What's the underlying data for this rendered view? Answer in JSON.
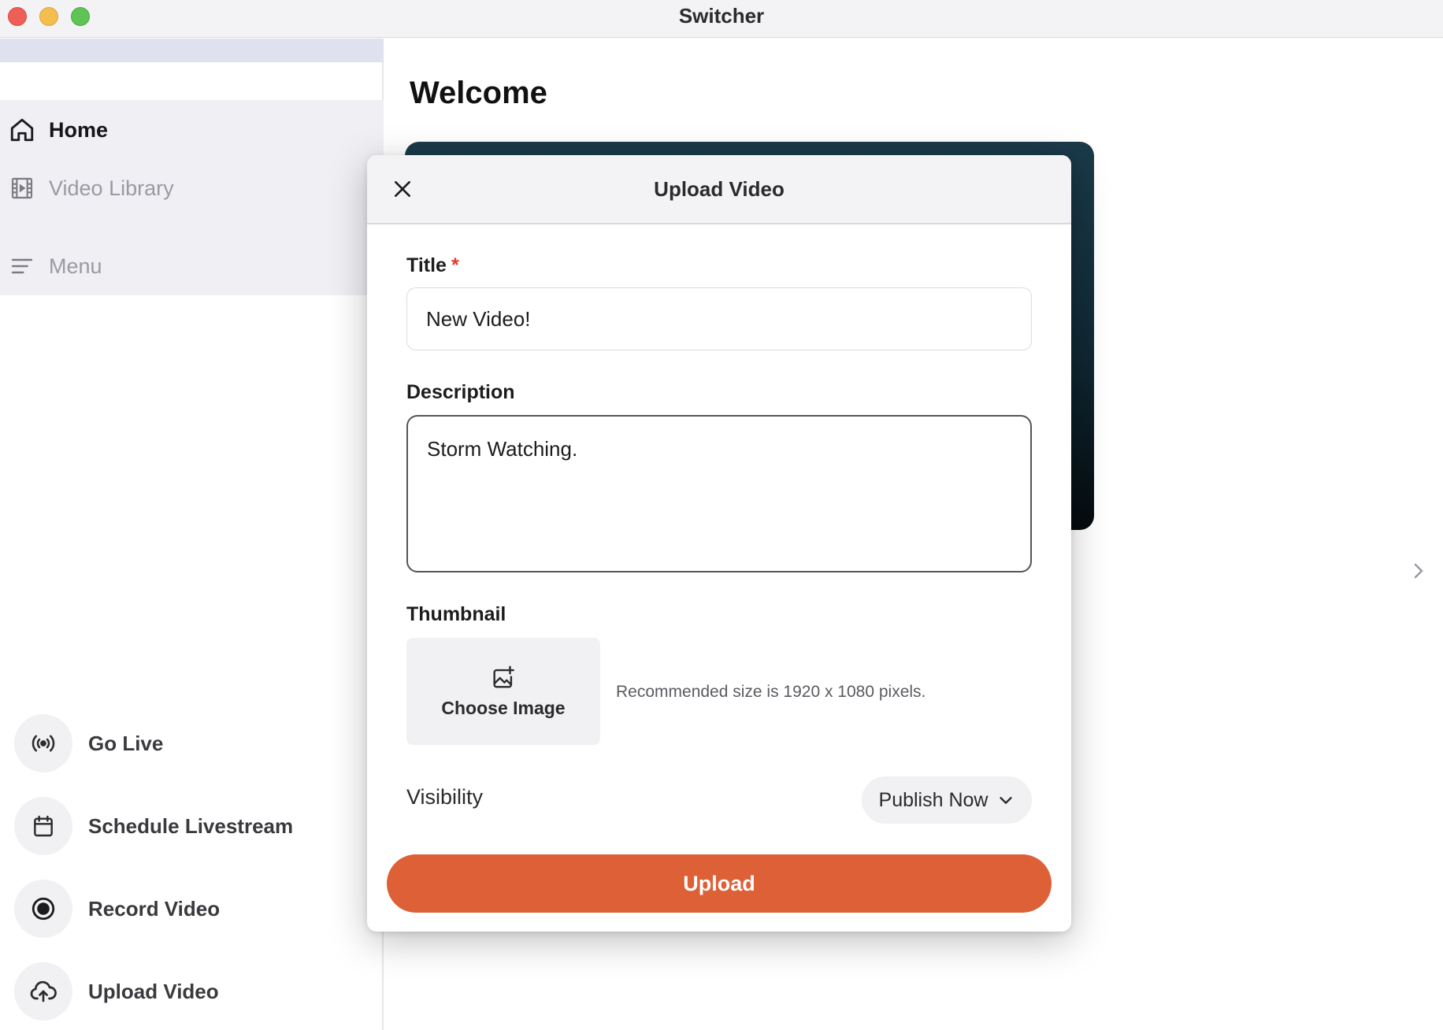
{
  "window": {
    "title": "Switcher"
  },
  "sidebar": {
    "nav": [
      {
        "label": "Home",
        "icon": "home-icon"
      },
      {
        "label": "Video Library",
        "icon": "film-icon"
      },
      {
        "label": "Menu",
        "icon": "menu-icon"
      }
    ],
    "actions": [
      {
        "label": "Go Live",
        "icon": "broadcast-icon"
      },
      {
        "label": "Schedule Livestream",
        "icon": "calendar-icon"
      },
      {
        "label": "Record Video",
        "icon": "record-icon"
      },
      {
        "label": "Upload Video",
        "icon": "cloud-upload-icon"
      }
    ]
  },
  "main": {
    "heading": "Welcome"
  },
  "modal": {
    "title": "Upload Video",
    "title_field": {
      "label": "Title",
      "required_mark": "*",
      "value": "New Video!"
    },
    "description_field": {
      "label": "Description",
      "value": "Storm Watching."
    },
    "thumbnail": {
      "label": "Thumbnail",
      "button_label": "Choose Image",
      "hint": "Recommended size is 1920 x 1080 pixels."
    },
    "visibility": {
      "label": "Visibility",
      "selected": "Publish Now"
    },
    "upload_label": "Upload"
  },
  "colors": {
    "accent": "#dd6036",
    "required": "#e23b2e",
    "sidebar_bg": "#efeff4",
    "hero_dark": "#0f2833"
  }
}
